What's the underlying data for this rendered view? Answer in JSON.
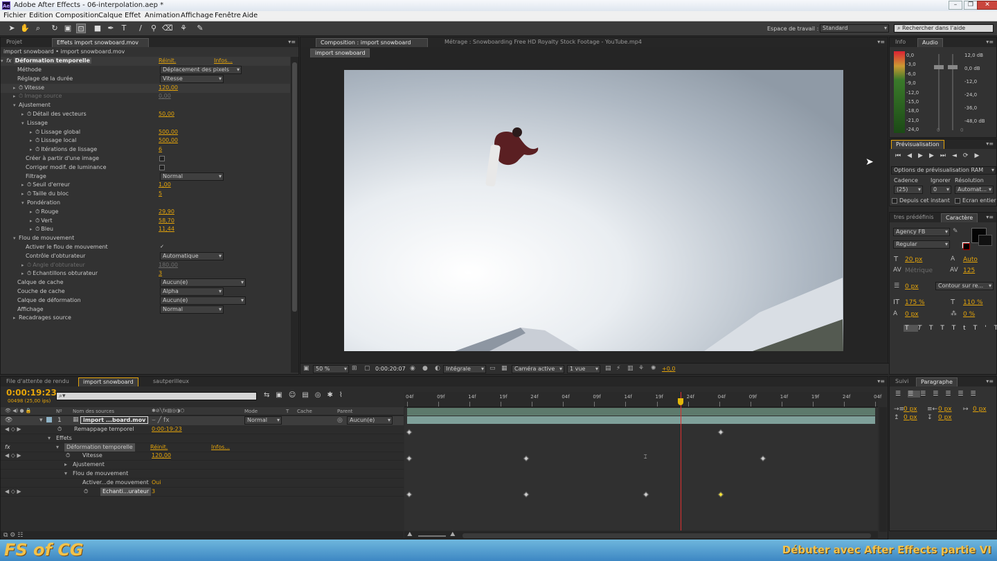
{
  "window": {
    "title": "Adobe After Effects - 06-interpolation.aep *",
    "app_icon": "Ae"
  },
  "menu": [
    "Fichier",
    "Edition",
    "Composition",
    "Calque",
    "Effet",
    "Animation",
    "Affichage",
    "Fenêtre",
    "Aide"
  ],
  "toolbar": {
    "workspace_label": "Espace de travail :",
    "workspace_value": "Standard",
    "help_placeholder": "Rechercher dans l'aide"
  },
  "left_panel": {
    "tabs": [
      "Projet",
      "Effets import snowboard.mov"
    ],
    "breadcrumb": "import snowboard • import snowboard.mov",
    "effect_name": "Déformation temporelle",
    "reset": "Réinit.",
    "about": "Infos...",
    "rows": [
      {
        "label": "Méthode",
        "dropdown": "Déplacement des pixels"
      },
      {
        "label": "Réglage de la durée",
        "dropdown": "Vitesse"
      },
      {
        "label": "Vitesse",
        "value": "120,00"
      },
      {
        "label": "Image source",
        "value": "0,00"
      },
      {
        "label": "Ajustement"
      },
      {
        "label": "Détail des vecteurs",
        "value": "50,00"
      },
      {
        "label": "Lissage"
      },
      {
        "label": "Lissage global",
        "value": "500,00"
      },
      {
        "label": "Lissage local",
        "value": "500,00"
      },
      {
        "label": "Itérations de lissage",
        "value": "6"
      },
      {
        "label": "Créer à partir d'une image"
      },
      {
        "label": "Corriger modif. de luminance"
      },
      {
        "label": "Filtrage",
        "dropdown": "Normal"
      },
      {
        "label": "Seuil d'erreur",
        "value": "1,00"
      },
      {
        "label": "Taille du bloc",
        "value": "5"
      },
      {
        "label": "Pondération"
      },
      {
        "label": "Rouge",
        "value": "29,90"
      },
      {
        "label": "Vert",
        "value": "58,70"
      },
      {
        "label": "Bleu",
        "value": "11,44"
      },
      {
        "label": "Flou de mouvement"
      },
      {
        "label": "Activer le flou de mouvement",
        "checked": "✓"
      },
      {
        "label": "Contrôle d'obturateur",
        "dropdown": "Automatique"
      },
      {
        "label": "Angle d'obturateur",
        "value": "180,00"
      },
      {
        "label": "Echantillons obturateur",
        "value": "3"
      },
      {
        "label": "Calque de cache",
        "dropdown": "Aucun(e)"
      },
      {
        "label": "Couche de cache",
        "dropdown": "Alpha"
      },
      {
        "label": "Calque de déformation",
        "dropdown": "Aucun(e)"
      },
      {
        "label": "Affichage",
        "dropdown": "Normal"
      },
      {
        "label": "Recadrages source"
      }
    ]
  },
  "viewer": {
    "tabs": [
      "Composition : import snowboard",
      "Métrage : Snowboarding Free HD Royalty Stock Footage - YouTube.mp4"
    ],
    "subtab": "import snowboard",
    "zoom": "50 %",
    "timecode": "0:00:20:07",
    "quality": "Intégrale",
    "camera": "Caméra active",
    "views": "1 vue",
    "exposure": "+0,0"
  },
  "audio_panel": {
    "tabs": [
      "Info",
      "Audio"
    ],
    "left_scale": [
      "0,0",
      "-3,0",
      "-6,0",
      "-9,0",
      "-12,0",
      "-15,0",
      "-18,0",
      "-21,0",
      "-24,0"
    ],
    "right_scale": [
      "12,0 dB",
      "0,0 dB",
      "-12,0",
      "-24,0",
      "-36,0",
      "-48,0 dB"
    ],
    "fader_zero": "0"
  },
  "preview_panel": {
    "tab": "Prévisualisation",
    "ram_options": "Options de prévisualisation RAM",
    "cadence_label": "Cadence",
    "ignore_label": "Ignorer",
    "resolution_label": "Résolution",
    "cadence": "(25)",
    "ignore": "0",
    "resolution": "Automat...",
    "from_current": "Depuis cet instant",
    "fullscreen": "Ecran entier"
  },
  "character_panel": {
    "tabs": [
      "tres prédéfinis",
      "Caractère"
    ],
    "font": "Agency FB",
    "style": "Regular",
    "size": "20 px",
    "leading": "Auto",
    "kerning": "Métrique",
    "tracking": "125",
    "stroke_width": "0 px",
    "stroke_mode": "Contour sur re...",
    "vscale": "175 %",
    "hscale": "110 %",
    "baseline": "0 px",
    "tsume": "0 %"
  },
  "paragraph_panel": {
    "tabs": [
      "Suivi",
      "Paragraphe"
    ],
    "indents": [
      "0 px",
      "0 px",
      "0 px",
      "0 px",
      "0 px"
    ]
  },
  "timeline": {
    "tabs": [
      "File d'attente de rendu",
      "import snowboard",
      "sautperilleux"
    ],
    "timecode": "0:00:19:23",
    "frame_info": "00498 (25,00 ips)",
    "columns": [
      "Nº",
      "Nom des sources",
      "Mode",
      "T",
      "Cache",
      "Parent"
    ],
    "layer_num": "1",
    "layer_name": "import ...board.mov",
    "layer_mode": "Normal",
    "layer_parent": "Aucun(e)",
    "rows": [
      {
        "label": "Remappage temporel",
        "value": "0:00:19:23"
      },
      {
        "label": "Effets"
      },
      {
        "label": "Déformation temporelle",
        "reset": "Réinit.",
        "about": "Infos..."
      },
      {
        "label": "Vitesse",
        "value": "120,00"
      },
      {
        "label": "Ajustement"
      },
      {
        "label": "Flou de mouvement"
      },
      {
        "label": "Activer...de mouvement",
        "value": "Oui"
      },
      {
        "label": "Echanti...urateur",
        "value": "3"
      }
    ],
    "ruler": [
      "04f",
      "09f",
      "14f",
      "19f",
      "24f",
      "04f",
      "09f",
      "14f",
      "19f",
      "24f",
      "04f",
      "09f",
      "14f",
      "19f",
      "24f",
      "04f"
    ],
    "playhead_fraction": 0.585
  },
  "footer": {
    "logo": "FS of CG",
    "caption": "Débuter avec After Effects partie VI"
  }
}
